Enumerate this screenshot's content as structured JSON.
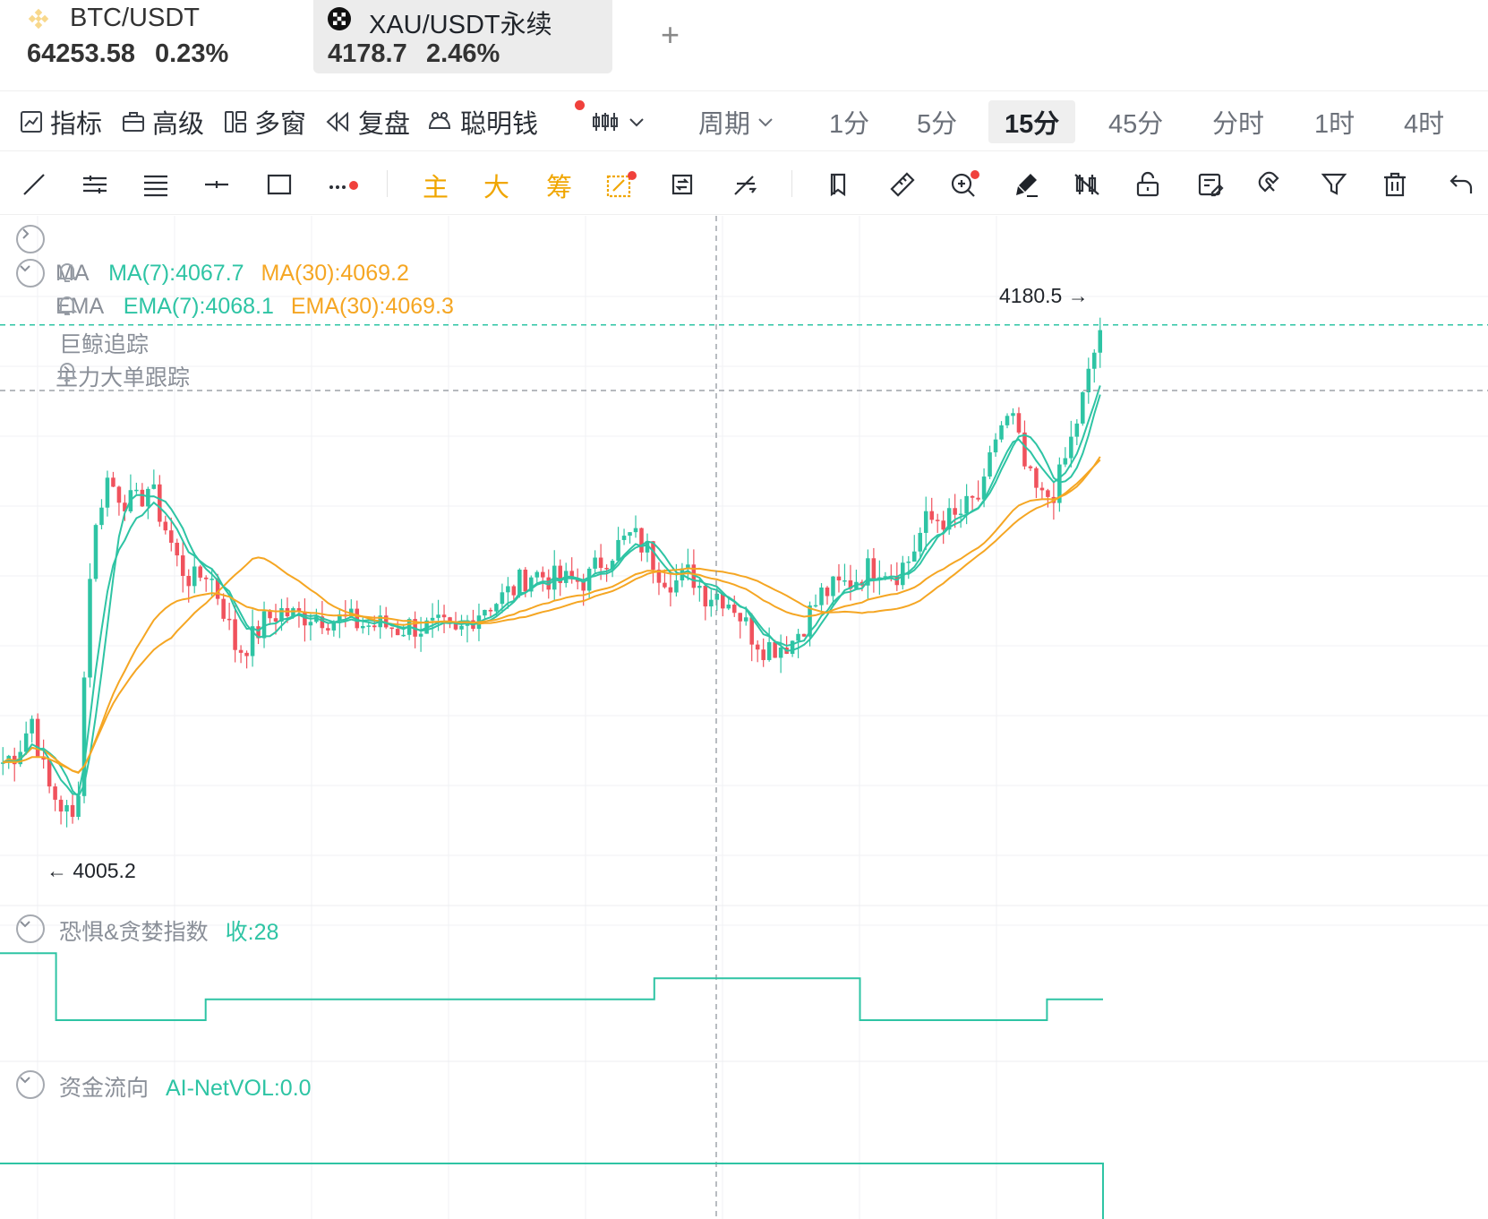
{
  "tickers": [
    {
      "name": "BTC/USDT",
      "price": "64253.58",
      "change": "0.23%",
      "icon": "binance-icon",
      "selected": false
    },
    {
      "name": "XAU/USDT永续",
      "price": "4178.7",
      "change": "2.46%",
      "icon": "okx-icon",
      "selected": true
    }
  ],
  "add_tab": "+",
  "toolbar": {
    "indicators": "指标",
    "advanced": "高级",
    "multi_window": "多窗",
    "replay": "复盘",
    "smart_money": "聪明钱",
    "period": "周期",
    "periods": [
      "1分",
      "5分",
      "15分",
      "45分",
      "分时",
      "1时",
      "4时"
    ],
    "active_period": "15分"
  },
  "drawing_tools": {
    "main_label": "主",
    "big_label": "大",
    "chip_label": "筹"
  },
  "legend": {
    "ma": {
      "name": "MA",
      "ma7": "MA(7):4067.7",
      "ma30": "MA(30):4069.2"
    },
    "ema": {
      "name": "EMA",
      "ema7": "EMA(7):4068.1",
      "ema30": "EMA(30):4069.3"
    },
    "whale": "巨鲸追踪",
    "big_order": "主力大单跟踪"
  },
  "price_marks": {
    "high": "4180.5 →",
    "low": "← 4005.2"
  },
  "fear_greed": {
    "title": "恐惧&贪婪指数",
    "value": "收:28"
  },
  "money_flow": {
    "title": "资金流向",
    "value": "AI-NetVOL:0.0"
  },
  "colors": {
    "up": "#2ec4a4",
    "down": "#f0525d",
    "ma7": "#2ec4a4",
    "ma30": "#f5a623",
    "accent_dot": "#f0413c"
  },
  "chart_data": {
    "type": "candlestick",
    "price_range": [
      3990,
      4190
    ],
    "price_closes": [
      4030,
      4034,
      4045,
      4022,
      4015,
      4008,
      4100,
      4128,
      4122,
      4118,
      4125,
      4112,
      4098,
      4092,
      4096,
      4084,
      4068,
      4072,
      4079,
      4082,
      4080,
      4081,
      4080,
      4079,
      4078,
      4077,
      4077,
      4076,
      4077,
      4076,
      4076,
      4073,
      4080,
      4084,
      4086,
      4090,
      4095,
      4094,
      4092,
      4092,
      4093,
      4100,
      4104,
      4108,
      4103,
      4095,
      4092,
      4095,
      4088,
      4088,
      4084,
      4075,
      4070,
      4070,
      4072,
      4080,
      4088,
      4090,
      4092,
      4096,
      4098,
      4095,
      4100,
      4112,
      4114,
      4113,
      4118,
      4122,
      4145,
      4148,
      4128,
      4120,
      4124,
      4140,
      4158,
      4179
    ],
    "fear_greed": [
      50,
      50,
      50,
      18,
      18,
      18,
      18,
      18,
      18,
      18,
      18,
      28,
      28,
      28,
      28,
      28,
      28,
      28,
      28,
      28,
      28,
      28,
      28,
      28,
      28,
      28,
      28,
      28,
      28,
      28,
      28,
      28,
      28,
      28,
      28,
      38,
      38,
      38,
      38,
      38,
      38,
      38,
      38,
      38,
      38,
      38,
      18,
      18,
      18,
      18,
      18,
      18,
      18,
      18,
      18,
      18,
      28,
      28,
      28
    ],
    "fear_greed_range": [
      0,
      60
    ],
    "net_vol": 0.0
  }
}
